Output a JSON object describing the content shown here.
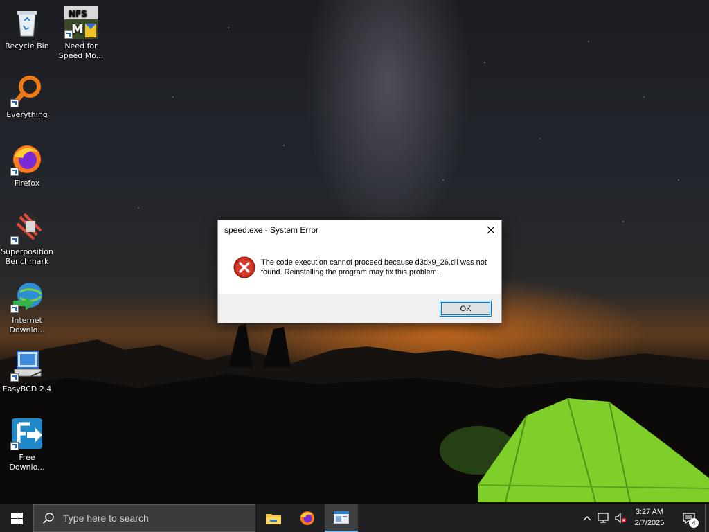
{
  "desktop": {
    "icons": [
      {
        "label": "Recycle Bin",
        "icon": "recycle-bin-icon"
      },
      {
        "label": "Need for Speed Mo...",
        "icon": "nfs-game-icon"
      },
      {
        "label": "Everything",
        "icon": "everything-search-icon"
      },
      {
        "label": "Firefox",
        "icon": "firefox-icon"
      },
      {
        "label": "Superposition Benchmark",
        "icon": "superposition-icon"
      },
      {
        "label": "Internet Downlo...",
        "icon": "internet-download-manager-icon"
      },
      {
        "label": "EasyBCD 2.4",
        "icon": "easybcd-icon"
      },
      {
        "label": "Free Downlo...",
        "icon": "free-download-manager-icon"
      }
    ]
  },
  "dialog": {
    "title": "speed.exe - System Error",
    "message": "The code execution cannot proceed because d3dx9_26.dll was not found. Reinstalling the program may fix this problem.",
    "ok_label": "OK",
    "icon": "error-icon"
  },
  "taskbar": {
    "search_placeholder": "Type here to search",
    "apps": [
      "file-explorer-icon",
      "firefox-icon",
      "active-window-icon"
    ],
    "clock": {
      "time": "3:27 AM",
      "date": "2/7/2025"
    },
    "notification_count": "4"
  },
  "colors": {
    "accent": "#0078d7",
    "error_red": "#c42b1c",
    "taskbar": "#1f2022"
  }
}
